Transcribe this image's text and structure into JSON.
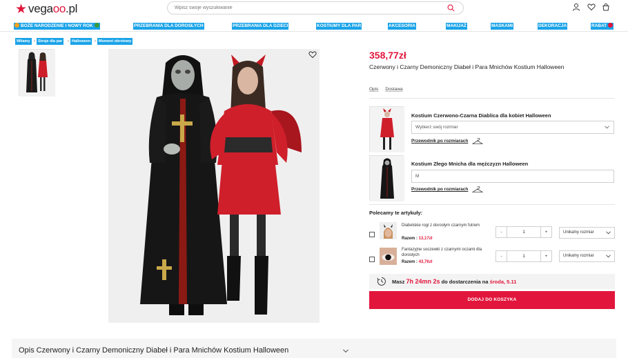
{
  "header": {
    "logo_text_1": "vega",
    "logo_text_2": "oo",
    "logo_text_3": ".pl",
    "search_placeholder": "Wpisz swoje wyszukiwanie"
  },
  "nav": {
    "items": [
      "BOŻE NARODZENIE I NOWY ROK",
      "PRZEBRANIA DLA DOROSŁYCH",
      "PRZEBRANIA DLA DZIECI",
      "KOSTIUMY DLA PAR",
      "AKCESORIA",
      "MAKIJAŻ",
      "MASKAMI",
      "DEKORACJA",
      "RABAT"
    ]
  },
  "breadcrumb": [
    "Witamy",
    "Stroje dla par",
    "Halloween",
    "Moment obrotowy"
  ],
  "product": {
    "price": "358,77zł",
    "title": "Czerwony i Czarny Demoniczny Diabeł i Para Mnichów Kostium Halloween",
    "tabs": [
      "Opis",
      "Dostawa"
    ]
  },
  "variants": [
    {
      "label": "Kostium Czerwono-Czarna Diablica dla kobiet Halloween",
      "select_value": "Wybierz swój rozmiar",
      "guide": "Przewodnik po rozmiarach"
    },
    {
      "label": "Kostium Złego Mnicha dla mężczyzn Halloween",
      "select_value": "M",
      "guide": "Przewodnik po rozmiarach"
    }
  ],
  "recommended": {
    "title": "Polecamy te artykuły:",
    "items": [
      {
        "name": "Diabelskie rogi z dorosłym czarnym futrem",
        "price_label": "Razem :",
        "price": "13,17zł",
        "qty_minus": "-",
        "qty": "1",
        "qty_plus": "+",
        "size": "Unikalny rozmiar"
      },
      {
        "name": "Fantazyjne soczewki z czarnymi oczami dla dorosłych",
        "price_label": "Razem :",
        "price": "43,76zł",
        "qty_minus": "-",
        "qty": "1",
        "qty_plus": "+",
        "size": "Unikalny rozmiar"
      }
    ]
  },
  "delivery": {
    "prefix": "Masz",
    "time": "7h 24mn 2s",
    "middle": "do dostarczenia na",
    "date": "środa, 5.11"
  },
  "add_to_cart": "DODAJ DO KOSZYKA",
  "bottom": {
    "title": "Opis Czerwony i Czarny Demoniczny Diabeł i Para Mnichów Kostium Halloween"
  },
  "colors": {
    "brand_red": "#e2163c",
    "nav_highlight": "#1aa3e8"
  }
}
